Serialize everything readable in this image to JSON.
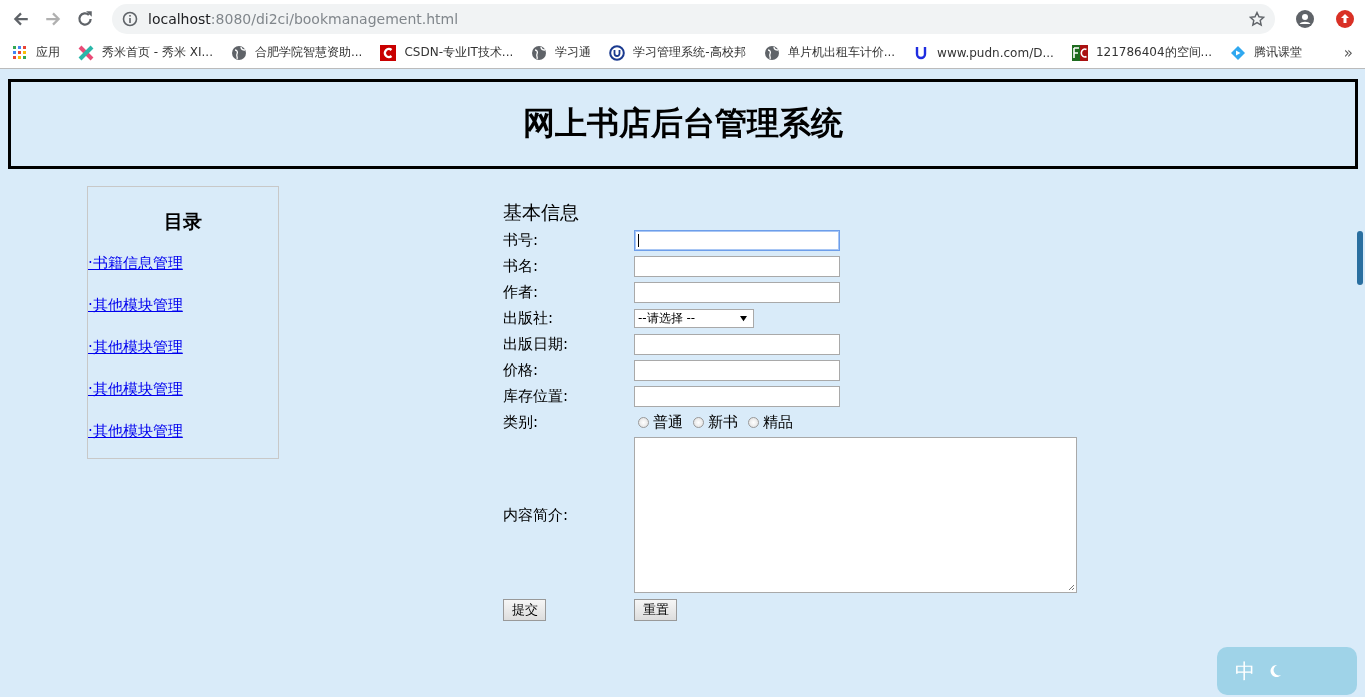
{
  "browser": {
    "url_host": "localhost",
    "url_rest": ":8080/di2ci/bookmanagement.html",
    "bookmarks": [
      {
        "kind": "apps",
        "label": "应用"
      },
      {
        "kind": "xiumi",
        "label": "秀米首页 - 秀米 XI..."
      },
      {
        "kind": "globe",
        "label": "合肥学院智慧资助..."
      },
      {
        "kind": "csdn",
        "label": "CSDN-专业IT技术..."
      },
      {
        "kind": "globe",
        "label": "学习通"
      },
      {
        "kind": "ucircle",
        "label": "学习管理系统-高校邦"
      },
      {
        "kind": "globe",
        "label": "单片机出租车计价..."
      },
      {
        "kind": "u",
        "label": "www.pudn.com/D..."
      },
      {
        "kind": "fc",
        "label": "121786404的空间..."
      },
      {
        "kind": "tencent",
        "label": "腾讯课堂"
      }
    ],
    "overflow": "»"
  },
  "header": {
    "title": "网上书店后台管理系统"
  },
  "sidebar": {
    "title": "目录",
    "items": [
      {
        "label": "·书籍信息管理"
      },
      {
        "label": "·其他模块管理"
      },
      {
        "label": "·其他模块管理"
      },
      {
        "label": "·其他模块管理"
      },
      {
        "label": "·其他模块管理"
      }
    ]
  },
  "form": {
    "title": "基本信息",
    "fields": [
      {
        "kind": "text",
        "label": "书号:",
        "focused": true
      },
      {
        "kind": "text",
        "label": "书名:",
        "focused": false
      },
      {
        "kind": "text",
        "label": "作者:",
        "focused": false
      },
      {
        "kind": "select",
        "label": "出版社:",
        "value": "--请选择 --"
      },
      {
        "kind": "text",
        "label": "出版日期:",
        "focused": false
      },
      {
        "kind": "text",
        "label": "价格:",
        "focused": false
      },
      {
        "kind": "text",
        "label": "库存位置:",
        "focused": false
      },
      {
        "kind": "radio",
        "label": "类别:",
        "options": [
          {
            "label": "普通",
            "selected": false
          },
          {
            "label": "新书",
            "selected": false
          },
          {
            "label": "精品",
            "selected": false
          }
        ]
      },
      {
        "kind": "textarea",
        "label": "内容简介:"
      }
    ],
    "buttons": [
      "提交",
      "重置"
    ]
  },
  "ime": {
    "label": "中"
  }
}
